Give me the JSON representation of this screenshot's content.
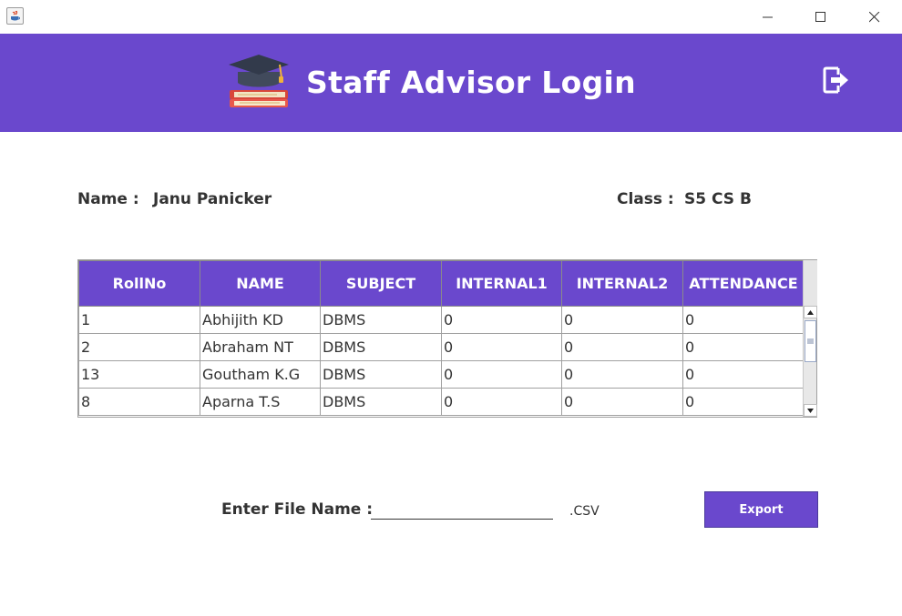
{
  "window": {
    "icons": {
      "app": "java-icon",
      "minimize": "minimize-icon",
      "maximize": "maximize-icon",
      "close": "close-icon"
    }
  },
  "header": {
    "title": "Staff Advisor Login",
    "logo_icon": "graduation-cap-books-icon",
    "logout_icon": "logout-icon",
    "background": "#6a48cd"
  },
  "info": {
    "name_label": "Name :",
    "name_value": "Janu Panicker",
    "class_label": "Class :",
    "class_value": "S5 CS B"
  },
  "table": {
    "columns": [
      "RollNo",
      "NAME",
      "SUBJECT",
      "INTERNAL1",
      "INTERNAL2",
      "ATTENDANCE"
    ],
    "rows": [
      [
        "1",
        "Abhijith KD",
        "DBMS",
        "0",
        "0",
        "0"
      ],
      [
        "2",
        "Abraham NT",
        "DBMS",
        "0",
        "0",
        "0"
      ],
      [
        "13",
        "Goutham K.G",
        "DBMS",
        "0",
        "0",
        "0"
      ],
      [
        "8",
        "Aparna T.S",
        "DBMS",
        "0",
        "0",
        "0"
      ]
    ]
  },
  "export": {
    "label": "Enter File Name :",
    "input_value": "",
    "extension": ".CSV",
    "button_label": "Export"
  },
  "colors": {
    "accent": "#6a48cd",
    "text": "#333333"
  }
}
